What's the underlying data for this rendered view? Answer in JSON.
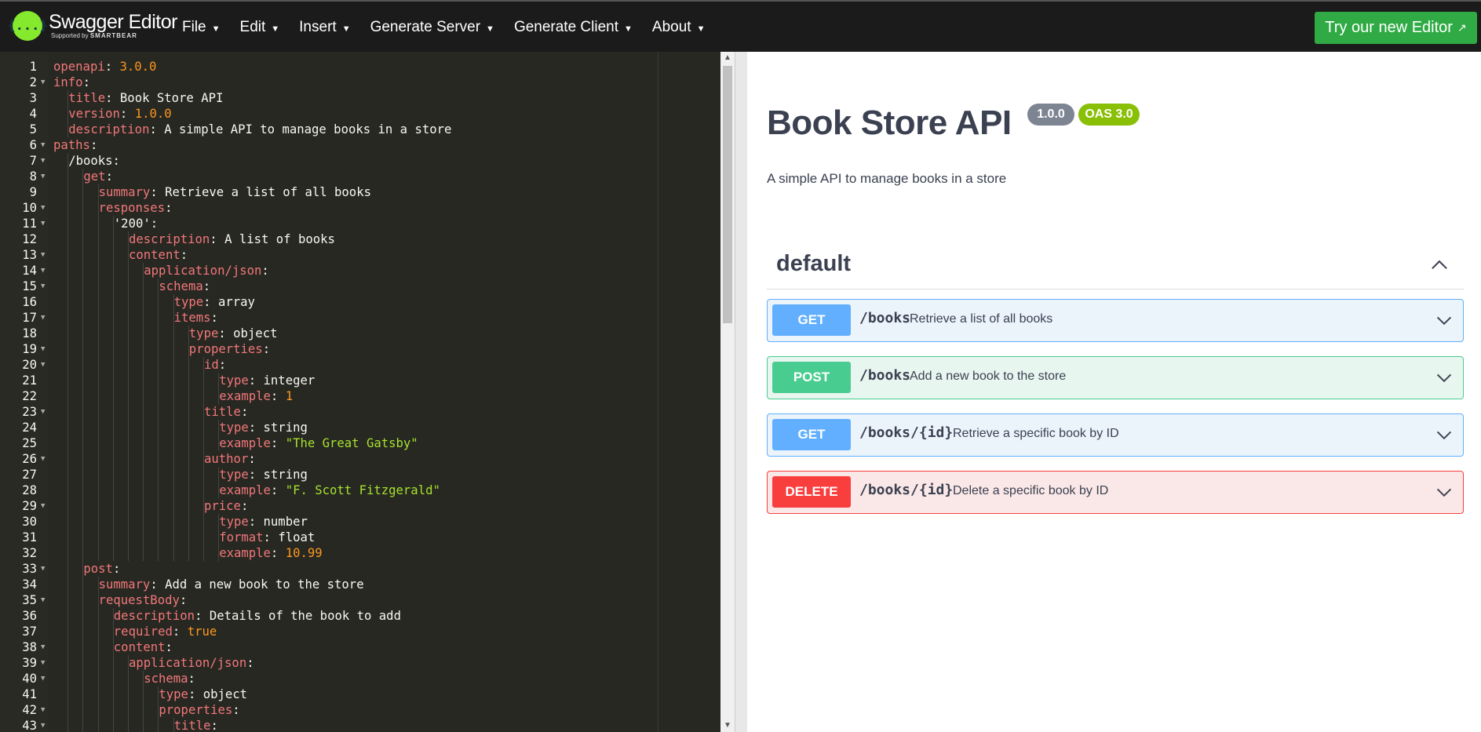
{
  "header": {
    "logo_glyph": "{...}",
    "logo_title": "Swagger Editor",
    "logo_sub_prefix": "Supported by",
    "logo_sub_brand": "SMARTBEAR",
    "menu": [
      "File",
      "Edit",
      "Insert",
      "Generate Server",
      "Generate Client",
      "About"
    ],
    "try_button": "Try our new Editor",
    "try_button_icon": "↗"
  },
  "editor": {
    "lines": [
      {
        "n": 1,
        "i": 0,
        "k": "openapi",
        "v": "3.0.0",
        "t": "n"
      },
      {
        "n": 2,
        "i": 0,
        "k": "info",
        "v": "",
        "t": "",
        "f": true
      },
      {
        "n": 3,
        "i": 1,
        "k": "title",
        "v": "Book Store API",
        "t": "p"
      },
      {
        "n": 4,
        "i": 1,
        "k": "version",
        "v": "1.0.0",
        "t": "n"
      },
      {
        "n": 5,
        "i": 1,
        "k": "description",
        "v": "A simple API to manage books in a store",
        "t": "p"
      },
      {
        "n": 6,
        "i": 0,
        "k": "paths",
        "v": "",
        "t": "",
        "f": true
      },
      {
        "n": 7,
        "i": 1,
        "k": "/books",
        "v": "",
        "t": "",
        "f": true,
        "kc": "p"
      },
      {
        "n": 8,
        "i": 2,
        "k": "get",
        "v": "",
        "t": "",
        "f": true
      },
      {
        "n": 9,
        "i": 3,
        "k": "summary",
        "v": "Retrieve a list of all books",
        "t": "p"
      },
      {
        "n": 10,
        "i": 3,
        "k": "responses",
        "v": "",
        "t": "",
        "f": true
      },
      {
        "n": 11,
        "i": 4,
        "k": "'200'",
        "v": "",
        "t": "",
        "f": true,
        "kc": "p"
      },
      {
        "n": 12,
        "i": 5,
        "k": "description",
        "v": "A list of books",
        "t": "p"
      },
      {
        "n": 13,
        "i": 5,
        "k": "content",
        "v": "",
        "t": "",
        "f": true
      },
      {
        "n": 14,
        "i": 6,
        "k": "application/json",
        "v": "",
        "t": "",
        "f": true
      },
      {
        "n": 15,
        "i": 7,
        "k": "schema",
        "v": "",
        "t": "",
        "f": true
      },
      {
        "n": 16,
        "i": 8,
        "k": "type",
        "v": "array",
        "t": "p"
      },
      {
        "n": 17,
        "i": 8,
        "k": "items",
        "v": "",
        "t": "",
        "f": true
      },
      {
        "n": 18,
        "i": 9,
        "k": "type",
        "v": "object",
        "t": "p"
      },
      {
        "n": 19,
        "i": 9,
        "k": "properties",
        "v": "",
        "t": "",
        "f": true
      },
      {
        "n": 20,
        "i": 10,
        "k": "id",
        "v": "",
        "t": "",
        "f": true
      },
      {
        "n": 21,
        "i": 11,
        "k": "type",
        "v": "integer",
        "t": "p"
      },
      {
        "n": 22,
        "i": 11,
        "k": "example",
        "v": "1",
        "t": "n"
      },
      {
        "n": 23,
        "i": 10,
        "k": "title",
        "v": "",
        "t": "",
        "f": true
      },
      {
        "n": 24,
        "i": 11,
        "k": "type",
        "v": "string",
        "t": "p"
      },
      {
        "n": 25,
        "i": 11,
        "k": "example",
        "v": "\"The Great Gatsby\"",
        "t": "s"
      },
      {
        "n": 26,
        "i": 10,
        "k": "author",
        "v": "",
        "t": "",
        "f": true
      },
      {
        "n": 27,
        "i": 11,
        "k": "type",
        "v": "string",
        "t": "p"
      },
      {
        "n": 28,
        "i": 11,
        "k": "example",
        "v": "\"F. Scott Fitzgerald\"",
        "t": "s"
      },
      {
        "n": 29,
        "i": 10,
        "k": "price",
        "v": "",
        "t": "",
        "f": true
      },
      {
        "n": 30,
        "i": 11,
        "k": "type",
        "v": "number",
        "t": "p"
      },
      {
        "n": 31,
        "i": 11,
        "k": "format",
        "v": "float",
        "t": "p"
      },
      {
        "n": 32,
        "i": 11,
        "k": "example",
        "v": "10.99",
        "t": "n"
      },
      {
        "n": 33,
        "i": 2,
        "k": "post",
        "v": "",
        "t": "",
        "f": true
      },
      {
        "n": 34,
        "i": 3,
        "k": "summary",
        "v": "Add a new book to the store",
        "t": "p"
      },
      {
        "n": 35,
        "i": 3,
        "k": "requestBody",
        "v": "",
        "t": "",
        "f": true
      },
      {
        "n": 36,
        "i": 4,
        "k": "description",
        "v": "Details of the book to add",
        "t": "p"
      },
      {
        "n": 37,
        "i": 4,
        "k": "required",
        "v": "true",
        "t": "n"
      },
      {
        "n": 38,
        "i": 4,
        "k": "content",
        "v": "",
        "t": "",
        "f": true
      },
      {
        "n": 39,
        "i": 5,
        "k": "application/json",
        "v": "",
        "t": "",
        "f": true
      },
      {
        "n": 40,
        "i": 6,
        "k": "schema",
        "v": "",
        "t": "",
        "f": true
      },
      {
        "n": 41,
        "i": 7,
        "k": "type",
        "v": "object",
        "t": "p"
      },
      {
        "n": 42,
        "i": 7,
        "k": "properties",
        "v": "",
        "t": "",
        "f": true
      },
      {
        "n": 43,
        "i": 8,
        "k": "title",
        "v": "",
        "t": "",
        "f": true
      }
    ]
  },
  "preview": {
    "title": "Book Store API",
    "version_badge": "1.0.0",
    "oas_badge": "OAS 3.0",
    "description": "A simple API to manage books in a store",
    "tag": "default",
    "operations": [
      {
        "method": "GET",
        "path": "/books",
        "summary": "Retrieve a list of all books",
        "kind": "get"
      },
      {
        "method": "POST",
        "path": "/books",
        "summary": "Add a new book to the store",
        "kind": "post"
      },
      {
        "method": "GET",
        "path": "/books/{id}",
        "summary": "Retrieve a specific book by ID",
        "kind": "get"
      },
      {
        "method": "DELETE",
        "path": "/books/{id}",
        "summary": "Delete a specific book by ID",
        "kind": "delete"
      }
    ]
  },
  "colors": {
    "get": "#61affe",
    "post": "#49cc90",
    "delete": "#f93e3e",
    "try_button": "#2faa44",
    "logo": "#85ea2d"
  }
}
